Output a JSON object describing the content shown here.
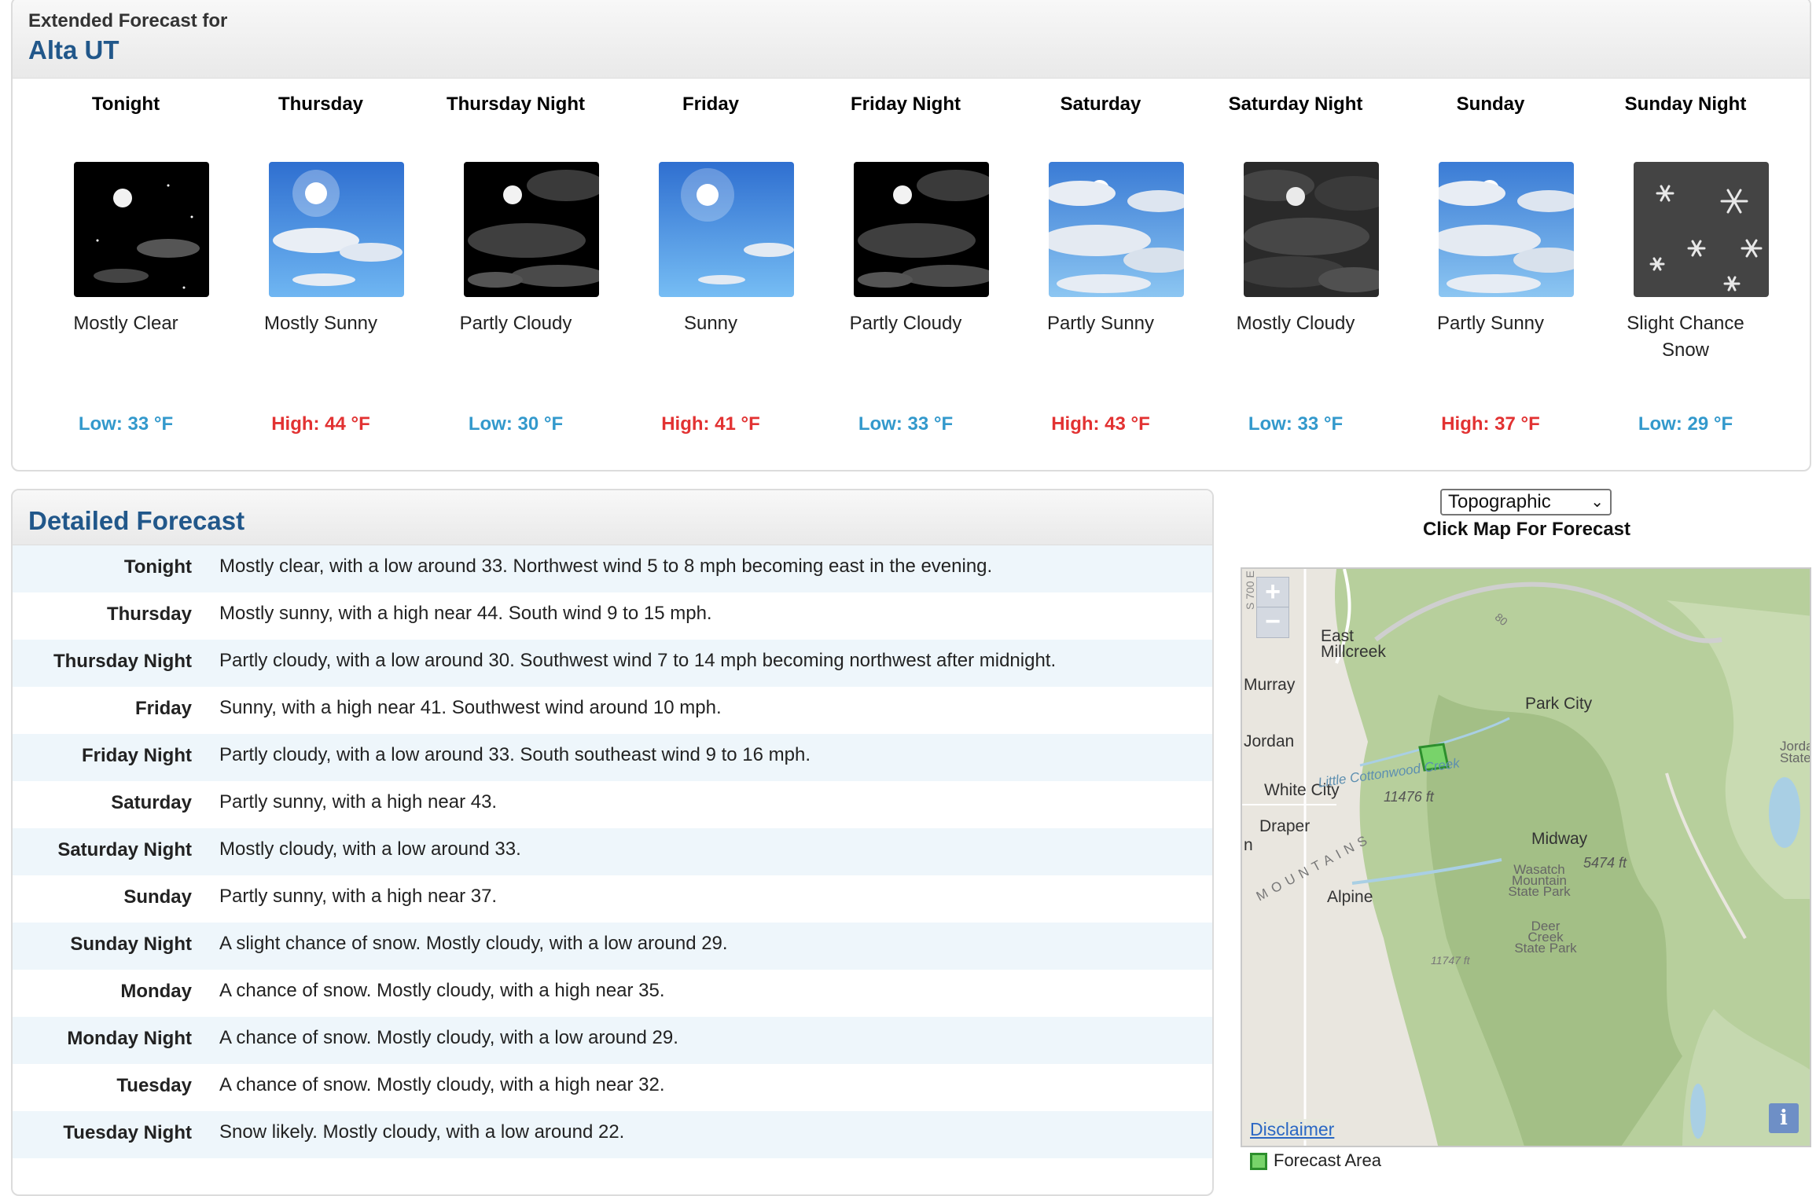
{
  "header": {
    "subtitle": "Extended Forecast for",
    "location": "Alta UT"
  },
  "periods": [
    {
      "name": "Tonight",
      "icon": "moon-few-clouds-icon",
      "desc": "Mostly Clear",
      "temp": "Low: 33 °F",
      "kind": "low"
    },
    {
      "name": "Thursday",
      "icon": "sun-few-clouds-icon",
      "desc": "Mostly Sunny",
      "temp": "High: 44 °F",
      "kind": "high"
    },
    {
      "name": "Thursday Night",
      "icon": "moon-clouds-icon",
      "desc": "Partly Cloudy",
      "temp": "Low: 30 °F",
      "kind": "low"
    },
    {
      "name": "Friday",
      "icon": "sun-icon",
      "desc": "Sunny",
      "temp": "High: 41 °F",
      "kind": "high"
    },
    {
      "name": "Friday Night",
      "icon": "moon-clouds-icon",
      "desc": "Partly Cloudy",
      "temp": "Low: 33 °F",
      "kind": "low"
    },
    {
      "name": "Saturday",
      "icon": "sun-clouds-icon",
      "desc": "Partly Sunny",
      "temp": "High: 43 °F",
      "kind": "high"
    },
    {
      "name": "Saturday Night",
      "icon": "moon-many-clouds-icon",
      "desc": "Mostly Cloudy",
      "temp": "Low: 33 °F",
      "kind": "low"
    },
    {
      "name": "Sunday",
      "icon": "sun-clouds-icon",
      "desc": "Partly Sunny",
      "temp": "High: 37 °F",
      "kind": "high"
    },
    {
      "name": "Sunday Night",
      "icon": "snow-icon",
      "desc": "Slight Chance Snow",
      "temp": "Low: 29 °F",
      "kind": "low"
    }
  ],
  "detailed": {
    "title": "Detailed Forecast",
    "rows": [
      {
        "label": "Tonight",
        "text": "Mostly clear, with a low around 33. Northwest wind 5 to 8 mph becoming east in the evening."
      },
      {
        "label": "Thursday",
        "text": "Mostly sunny, with a high near 44. South wind 9 to 15 mph."
      },
      {
        "label": "Thursday Night",
        "text": "Partly cloudy, with a low around 30. Southwest wind 7 to 14 mph becoming northwest after midnight."
      },
      {
        "label": "Friday",
        "text": "Sunny, with a high near 41. Southwest wind around 10 mph."
      },
      {
        "label": "Friday Night",
        "text": "Partly cloudy, with a low around 33. South southeast wind 9 to 16 mph."
      },
      {
        "label": "Saturday",
        "text": "Partly sunny, with a high near 43."
      },
      {
        "label": "Saturday Night",
        "text": "Mostly cloudy, with a low around 33."
      },
      {
        "label": "Sunday",
        "text": "Partly sunny, with a high near 37."
      },
      {
        "label": "Sunday Night",
        "text": "A slight chance of snow. Mostly cloudy, with a low around 29."
      },
      {
        "label": "Monday",
        "text": "A chance of snow. Mostly cloudy, with a high near 35."
      },
      {
        "label": "Monday Night",
        "text": "A chance of snow. Mostly cloudy, with a low around 29."
      },
      {
        "label": "Tuesday",
        "text": "A chance of snow. Mostly cloudy, with a high near 32."
      },
      {
        "label": "Tuesday Night",
        "text": "Snow likely. Mostly cloudy, with a low around 22."
      }
    ]
  },
  "map": {
    "layer_selected": "Topographic",
    "caption": "Click Map For Forecast",
    "zoom_in": "+",
    "zoom_out": "−",
    "labels": {
      "east_millcreek": "East Millcreek",
      "murray": "Murray",
      "park_city": "Park City",
      "jordan": "Jordan",
      "jordanelle_state": "Jorda State",
      "white_city": "White City",
      "creek": "Little Cottonwood Creek",
      "elev1": "11476 ft",
      "draper": "Draper",
      "midway": "Midway",
      "elev2": "5474 ft",
      "mountains": "MOUNTAINS",
      "wasatch": "Wasatch Mountain State Park",
      "alpine": "Alpine",
      "deer_creek": "Deer Creek State Park",
      "elev3": "11747 ft",
      "road_80": "80",
      "s700e": "S 700 E",
      "n": "n"
    },
    "disclaimer": "Disclaimer",
    "info": "i",
    "legend": "Forecast Area",
    "colors": {
      "forest": "#b7cf9c",
      "urban": "#e9e6df",
      "water": "#a9cfe4",
      "forecast_area": "#78d36a"
    }
  }
}
